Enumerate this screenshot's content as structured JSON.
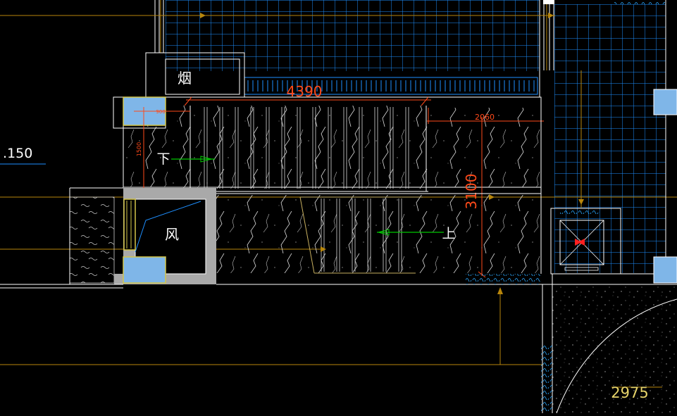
{
  "drawing": {
    "labels": {
      "chimney": "烟",
      "down": "下",
      "up": "上",
      "wind": "风",
      "elevation": ".150"
    },
    "dimensions": {
      "top_width": "4390",
      "right_width": "2060",
      "height": "3100",
      "small_h": "900",
      "small_v": "1500",
      "bottom_right": "2975"
    }
  },
  "colors": {
    "background": "#000000",
    "wall": "#ffffff",
    "grid": "#1e8fff",
    "dimension": "#ff4a1a",
    "axis": "#b8860b",
    "arrow": "#00c800",
    "column": "#7fb6e8",
    "gray_wall": "#a9a9a9",
    "text": "#ffffff"
  }
}
